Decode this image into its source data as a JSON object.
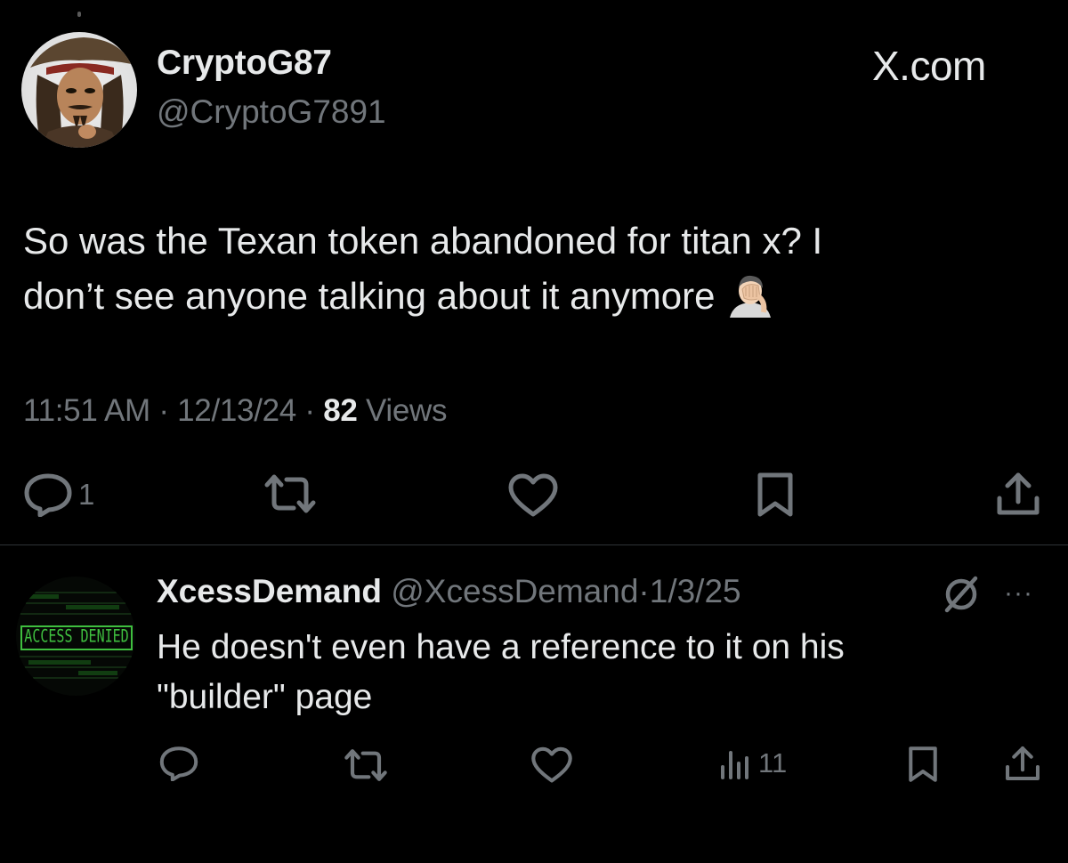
{
  "brand": {
    "watermark": "X.com"
  },
  "main_tweet": {
    "display_name": "CryptoG87",
    "handle": "@CryptoG7891",
    "text_line1": "So was the Texan token abandoned for titan x? I",
    "text_line2": "don’t see anyone talking about it anymore",
    "emoji": "facepalm",
    "time": "11:51 AM",
    "date": "12/13/24",
    "separator": "·",
    "views_count": "82",
    "views_label": "Views",
    "actions": {
      "reply_count": "1",
      "retweet_count": "",
      "like_count": "",
      "bookmark_count": ""
    }
  },
  "reply": {
    "display_name": "XcessDemand",
    "handle": "@XcessDemand",
    "separator": "·",
    "date": "1/3/25",
    "avatar_text": "ACCESS DENIED",
    "text_line1": "He doesn't even have a reference to it on his",
    "text_line2": "\"builder\" page",
    "more_label": "···",
    "actions": {
      "reply_count": "",
      "retweet_count": "",
      "like_count": "",
      "views_count": "11"
    }
  },
  "colors": {
    "background": "#000000",
    "text_primary": "#e7e9ea",
    "text_secondary": "#71767b",
    "divider": "#2f3336",
    "avatar_reply_green": "#3fbf3f"
  },
  "icons": {
    "reply": "reply-icon",
    "retweet": "retweet-icon",
    "like": "heart-icon",
    "bookmark": "bookmark-icon",
    "share": "share-icon",
    "views": "views-chart-icon",
    "grok": "grok-icon",
    "more": "more-icon"
  }
}
